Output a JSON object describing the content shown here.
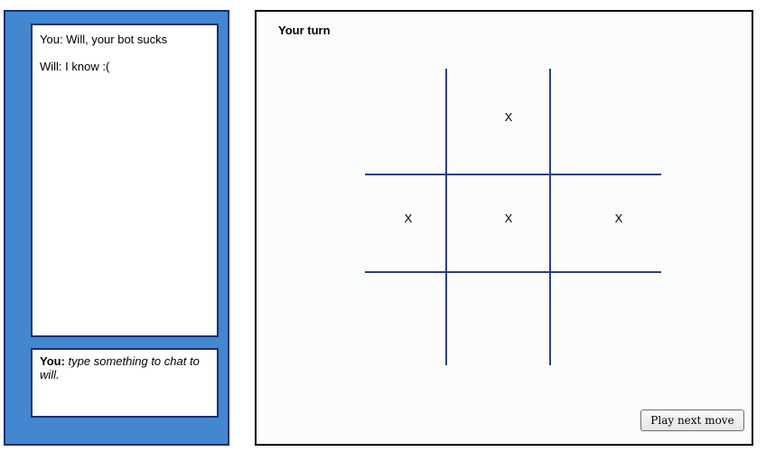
{
  "chat": {
    "messages": [
      "You: Will, your bot sucks",
      "Will: I know :("
    ],
    "input": {
      "speaker": "You:",
      "placeholder": "type something to chat to will."
    }
  },
  "game": {
    "status": "Your turn",
    "board": [
      "",
      "X",
      "",
      "X",
      "X",
      "X",
      "",
      "",
      ""
    ],
    "play_button_label": "Play next move"
  },
  "colors": {
    "panel_blue": "#4287cf",
    "border_navy": "#1c2f74",
    "grid_line": "#2a3f86"
  }
}
